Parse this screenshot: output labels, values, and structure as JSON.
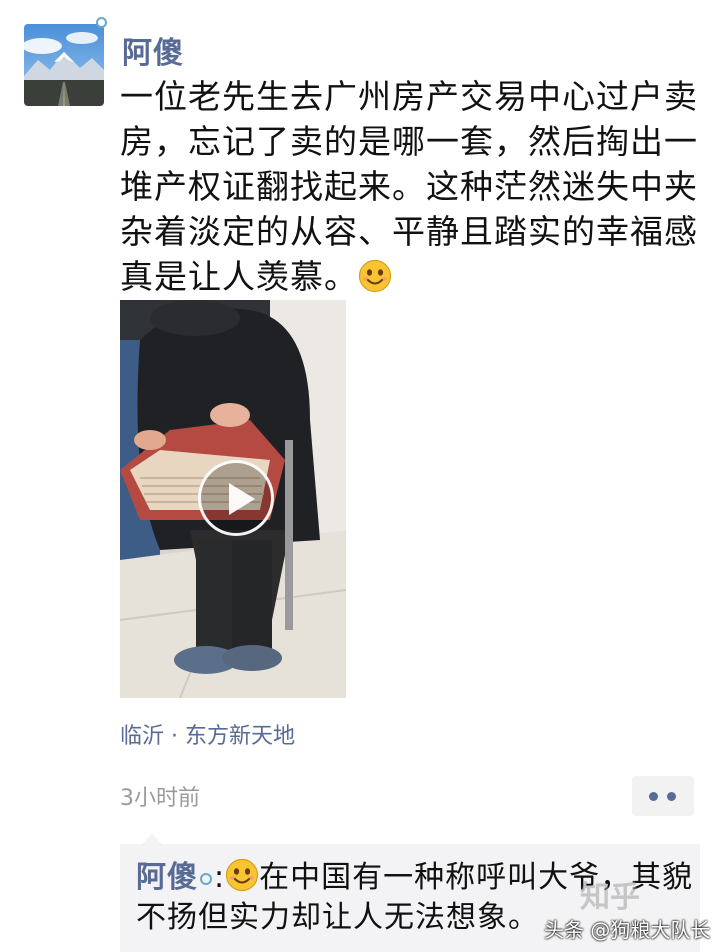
{
  "post": {
    "author": "阿傻",
    "text": "一位老先生去广州房产交易中心过户卖房，忘记了卖的是哪一套，然后掏出一堆产权证翻找起来。这种茫然迷失中夹杂着淡定的从容、平静且踏实的幸福感真是让人羡慕。",
    "location": "临沂 · 东方新天地",
    "time": "3小时前"
  },
  "comment": {
    "author": "阿傻",
    "separator": ":",
    "text": "在中国有一种称呼叫大爷，其貌不扬但实力却让人无法想象。"
  },
  "watermark": {
    "logo": "知乎",
    "text": "头条 @狗粮大队长"
  },
  "colors": {
    "link": "#576b95",
    "status_ring": "#6aa6d2",
    "comment_bg": "#f3f3f5"
  },
  "icons": {
    "avatar": "mountain-road-photo",
    "status": "ring-icon",
    "emoji": "smile-emoji",
    "play": "play-icon",
    "more": "more-dots-icon"
  }
}
